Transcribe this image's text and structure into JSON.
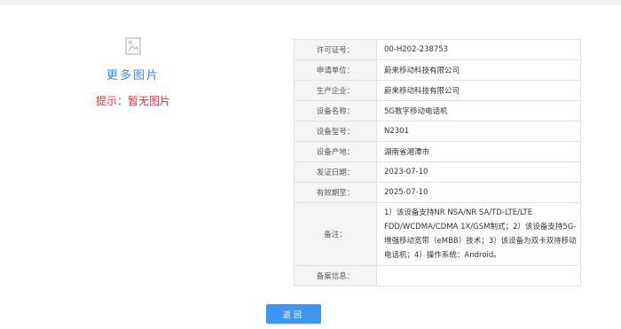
{
  "left": {
    "more_images": "更多图片",
    "hint": "提示：暂无图片"
  },
  "table": [
    {
      "label": "许可证号：",
      "value": "00-H202-238753"
    },
    {
      "label": "申请单位：",
      "value": "蔚来移动科技有限公司"
    },
    {
      "label": "生产企业：",
      "value": "蔚来移动科技有限公司"
    },
    {
      "label": "设备名称：",
      "value": "5G数字移动电话机"
    },
    {
      "label": "设备型号：",
      "value": "N2301"
    },
    {
      "label": "设备产地：",
      "value": "湖南省湘潭市"
    },
    {
      "label": "发证日期：",
      "value": "2023-07-10"
    },
    {
      "label": "有效期至：",
      "value": "2025-07-10"
    },
    {
      "label": "备注：",
      "value": "1）该设备支持NR NSA/NR SA/TD-LTE/LTE FDD/WCDMA/CDMA 1X/GSM制式；2）该设备支持5G-增强移动宽带（eMBB）技术；3）该设备为双卡双待移动电话机；4）操作系统：Android。"
    },
    {
      "label": "备案信息：",
      "value": ""
    }
  ],
  "back_button": "返回"
}
